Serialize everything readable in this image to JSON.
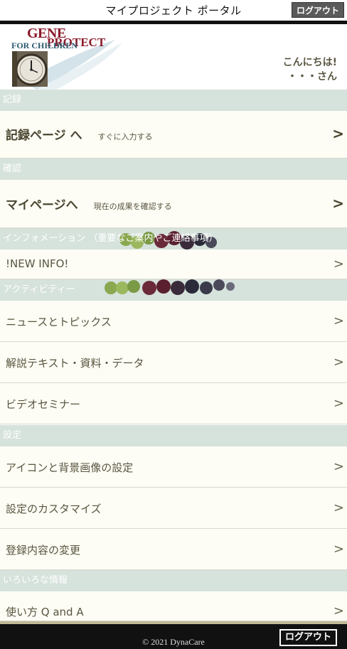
{
  "header": {
    "title": "マイプロジェクト ポータル",
    "logout_label": "ログアウト"
  },
  "logo": {
    "gene": "GENE",
    "protect": "PROTECT",
    "children": "FOR CHILDREN"
  },
  "greeting": {
    "line1": "こんにちは!",
    "line2": "・・・さん"
  },
  "sections": {
    "record": "記録",
    "confirm": "確認",
    "info": "インフォメーション （重要なご案内やご連絡事項）",
    "activity": "アクティビティー",
    "settings": "設定",
    "misc": "いろいろな情報"
  },
  "rows": {
    "record_page": {
      "label": "記録ページ へ",
      "sub": "すぐに入力する"
    },
    "my_page": {
      "label": "マイページへ",
      "sub": "現在の成果を確認する"
    },
    "new_info": "!NEW INFO!",
    "news": "ニュースとトピックス",
    "texts": "解説テキスト・資料・データ",
    "video": "ビデオセミナー",
    "icon_bg": "アイコンと背景画像の設定",
    "customize": "設定のカスタマイズ",
    "registration": "登録内容の変更",
    "faq": "使い方 Q and A"
  },
  "chevron": ">",
  "footer": {
    "copyright": "© 2021 DynaCare",
    "logout_label": "ログアウト"
  },
  "colors": {
    "section_bg": "#d6e2dc",
    "row_bg": "#fdfdf5",
    "text": "#5a5540",
    "footer_bg": "#111111",
    "brand_red": "#8a1b2b"
  }
}
